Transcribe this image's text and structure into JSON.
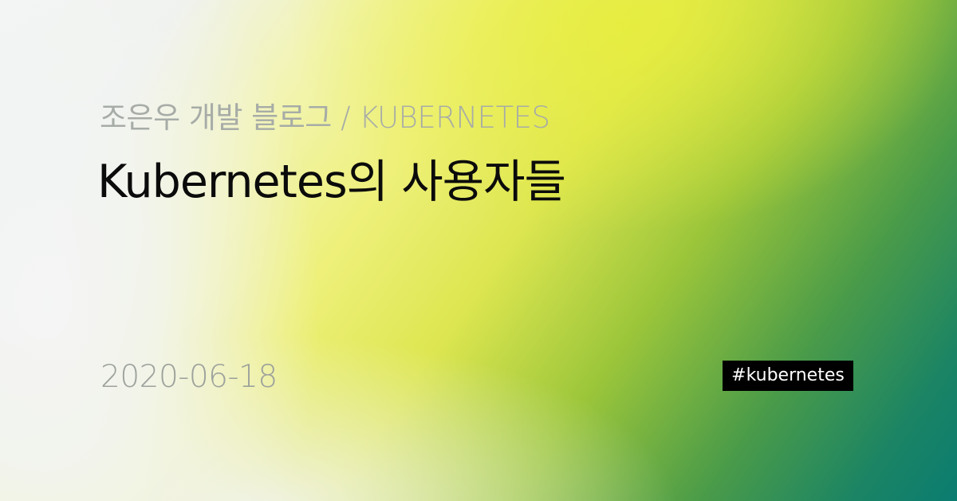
{
  "blog": {
    "subtitle": "조은우 개발 블로그 / KUBERNETES",
    "title": "Kubernetes의 사용자들",
    "date": "2020-06-18",
    "tags": [
      "#kubernetes"
    ]
  },
  "colors": {
    "title_text": "#0b0b0b",
    "muted_text": "#a7aca7",
    "tag_background": "#000000",
    "tag_text": "#ffffff",
    "gradient_start": "#f4f5f4",
    "gradient_yellow": "#eef07a",
    "gradient_green": "#4c9c48",
    "gradient_end": "#0a7c70"
  }
}
